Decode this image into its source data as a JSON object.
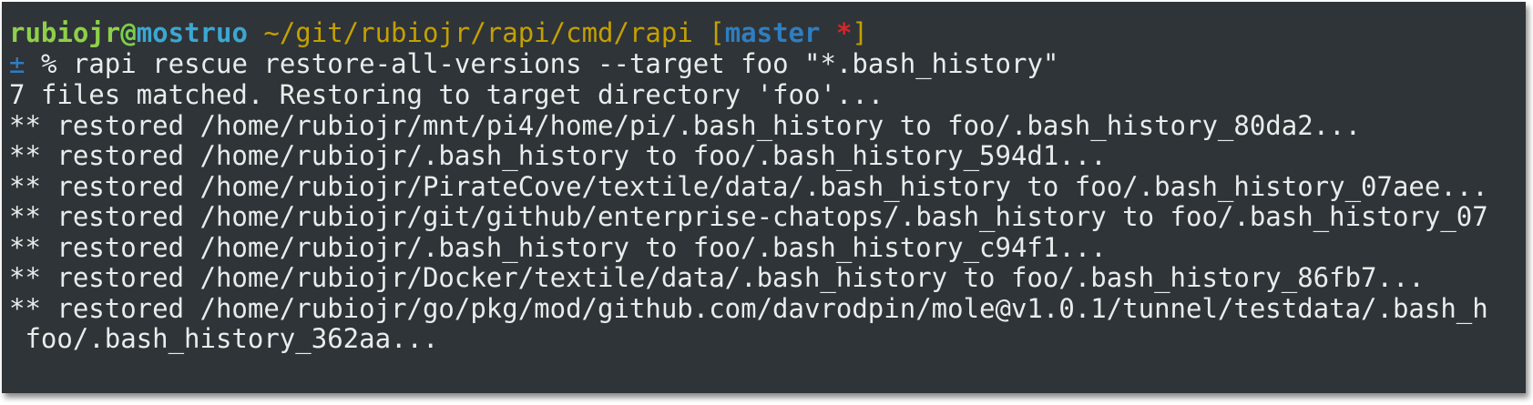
{
  "prompt": {
    "user": "rubiojr",
    "at": "@",
    "host": "mostruo",
    "path": "~/git/rubiojr/rapi/cmd/rapi",
    "bracket_open": "[",
    "branch": "master",
    "dirty_marker": "*",
    "bracket_close": "]",
    "status_symbol": "±",
    "prompt_char": "%",
    "command": "rapi rescue restore-all-versions --target foo \"*.bash_history\""
  },
  "output": [
    "7 files matched. Restoring to target directory 'foo'...",
    "** restored /home/rubiojr/mnt/pi4/home/pi/.bash_history to foo/.bash_history_80da2...",
    "** restored /home/rubiojr/.bash_history to foo/.bash_history_594d1...",
    "** restored /home/rubiojr/PirateCove/textile/data/.bash_history to foo/.bash_history_07aee...",
    "** restored /home/rubiojr/git/github/enterprise-chatops/.bash_history to foo/.bash_history_07",
    "** restored /home/rubiojr/.bash_history to foo/.bash_history_c94f1...",
    "** restored /home/rubiojr/Docker/textile/data/.bash_history to foo/.bash_history_86fb7...",
    "** restored /home/rubiojr/go/pkg/mod/github.com/davrodpin/mole@v1.0.1/tunnel/testdata/.bash_h",
    " foo/.bash_history_362aa..."
  ],
  "colors": {
    "background": "#2f3438",
    "text": "#e9ecec",
    "user": "#8ed04a",
    "host": "#3ba7d2",
    "path": "#c4a000",
    "branch": "#2f7ec0",
    "dirty": "#d6262a"
  }
}
